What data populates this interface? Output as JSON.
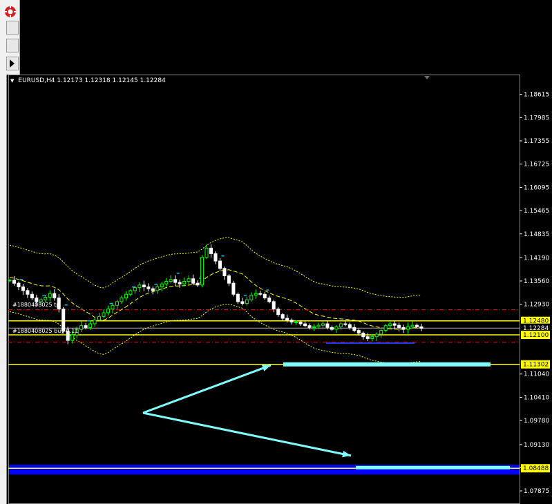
{
  "chart": {
    "symbol_line": "EURUSD,H4  1.12173 1.12318 1.12145 1.12284"
  },
  "order_labels": {
    "tp": "#1880408025 tp",
    "buy": "#1880408025 buy 0.11"
  },
  "price_tags": [
    {
      "label": "1.12480",
      "price": 1.1248,
      "fill": "#ffff00",
      "text": "#000000"
    },
    {
      "label": "1.12284",
      "price": 1.12284,
      "fill": "#000000",
      "text": "#ffffff"
    },
    {
      "label": "1.12100",
      "price": 1.121,
      "fill": "#ffff00",
      "text": "#000000"
    },
    {
      "label": "1.11302",
      "price": 1.11302,
      "fill": "#ffff00",
      "text": "#000000"
    },
    {
      "label": "1.08488",
      "price": 1.08488,
      "fill": "#ffff00",
      "text": "#000000"
    }
  ],
  "colors": {
    "background": "#000000",
    "bull_candle": "#00ff00",
    "bear_candle": "#ffffff",
    "horizontal_line": "#ffff00",
    "dashed_order_line": "#ff0000",
    "zone_fill": "#0000ff",
    "arrow": "#80ffff",
    "marker": "#00c0ff",
    "bands": "#ffff00"
  },
  "chart_data": {
    "type": "candlestick",
    "symbol": "EURUSD",
    "timeframe": "H4",
    "ohlc_last": {
      "open": 1.12173,
      "high": 1.12318,
      "low": 1.12145,
      "close": 1.12284
    },
    "y_ticks": [
      "1.18615",
      "1.17985",
      "1.17355",
      "1.16725",
      "1.16095",
      "1.15465",
      "1.14835",
      "1.14190",
      "1.13560",
      "1.12930",
      "1.11040",
      "1.10410",
      "1.09780",
      "1.09130",
      "1.08500",
      "1.07875"
    ],
    "ylim": [
      1.0752,
      1.1915
    ],
    "horizontal_lines": [
      1.1248,
      1.121,
      1.11302,
      1.08488
    ],
    "order_lines": {
      "tp": 1.1278,
      "buy": 1.1203
    },
    "blue_zone": [
      1.0832,
      1.0858
    ],
    "close_path": [
      1.1358,
      1.135,
      1.134,
      1.133,
      1.132,
      1.131,
      1.13,
      1.1305,
      1.1312,
      1.1322,
      1.131,
      1.128,
      1.122,
      1.1195,
      1.121,
      1.1225,
      1.1235,
      1.123,
      1.124,
      1.125,
      1.126,
      1.127,
      1.128,
      1.129,
      1.13,
      1.131,
      1.132,
      1.133,
      1.1338,
      1.1345,
      1.134,
      1.1335,
      1.133,
      1.134,
      1.1348,
      1.1355,
      1.136,
      1.1352,
      1.1348,
      1.1355,
      1.1362,
      1.135,
      1.1345,
      1.142,
      1.1445,
      1.143,
      1.141,
      1.139,
      1.137,
      1.135,
      1.132,
      1.13,
      1.1295,
      1.1305,
      1.1318,
      1.1322,
      1.132,
      1.131,
      1.13,
      1.128,
      1.1265,
      1.1255,
      1.125,
      1.1245,
      1.1245,
      1.124,
      1.1235,
      1.123,
      1.1232,
      1.1236,
      1.124,
      1.123,
      1.1225,
      1.1232,
      1.124,
      1.1238,
      1.123,
      1.1222,
      1.1215,
      1.1205,
      1.12,
      1.1205,
      1.1212,
      1.1222,
      1.1235,
      1.124,
      1.1236,
      1.123,
      1.1225,
      1.1232,
      1.1236,
      1.1232,
      1.1228
    ]
  }
}
